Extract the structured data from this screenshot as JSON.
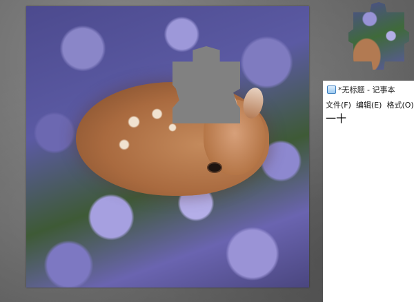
{
  "notepad": {
    "title": "*无标题 - 记事本",
    "menu": [
      "文件(F)",
      "编辑(E)",
      "格式(O)"
    ],
    "content": "一十"
  },
  "colors": {
    "background": "#6c6c6c",
    "flowers": "#8a86c8",
    "fawn": "#b57647"
  },
  "icons": [
    "notepad-icon"
  ]
}
